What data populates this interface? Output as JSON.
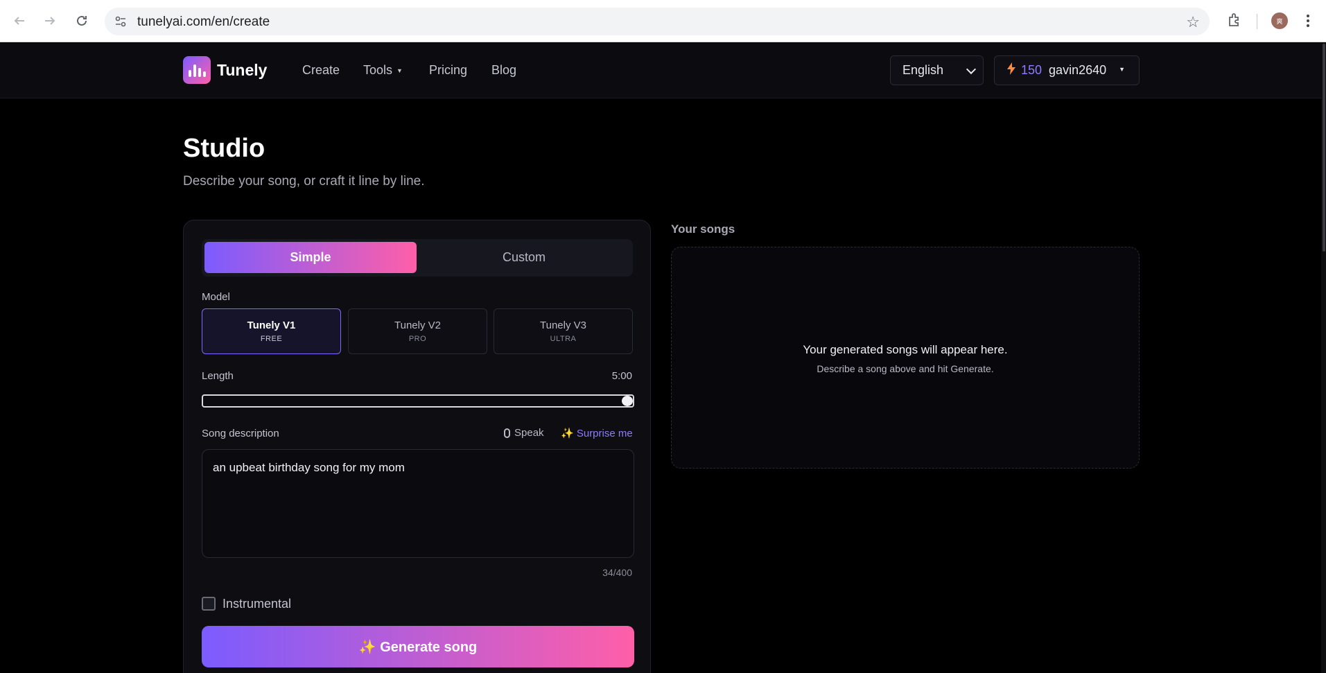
{
  "browser": {
    "url": "tunelyai.com/en/create",
    "profile_initial": "爽"
  },
  "header": {
    "brand": "Tunely",
    "nav": {
      "create": "Create",
      "tools": "Tools",
      "pricing": "Pricing",
      "blog": "Blog"
    },
    "language": "English",
    "credits": "150",
    "username": "gavin2640",
    "icons": {
      "logo": "bars-logo-icon",
      "credits": "lightning-bolt-icon"
    }
  },
  "page": {
    "title": "Studio",
    "subtitle": "Describe your song, or craft it line by line."
  },
  "form": {
    "modes": {
      "simple": "Simple",
      "custom": "Custom",
      "selected": "Simple"
    },
    "model_label": "Model",
    "models": [
      {
        "name": "Tunely V1",
        "tier": "FREE",
        "selected": true
      },
      {
        "name": "Tunely V2",
        "tier": "PRO",
        "selected": false
      },
      {
        "name": "Tunely V3",
        "tier": "ULTRA",
        "selected": false
      }
    ],
    "length_label": "Length",
    "length_value": "5:00",
    "length_fraction": 1.0,
    "description_label": "Song description",
    "speak": "Speak",
    "surprise": "✨ Surprise me",
    "description_value": "an upbeat birthday song for my mom",
    "char_count": "34/400",
    "instrumental_label": "Instrumental",
    "instrumental_checked": false,
    "generate": "✨ Generate song"
  },
  "songs": {
    "title": "Your songs",
    "empty_title": "Your generated songs will appear here.",
    "empty_sub": "Describe a song above and hit Generate."
  },
  "colors": {
    "accent_start": "#7b5cff",
    "accent_end": "#ff5fa8",
    "credits": "#8d7cff"
  }
}
